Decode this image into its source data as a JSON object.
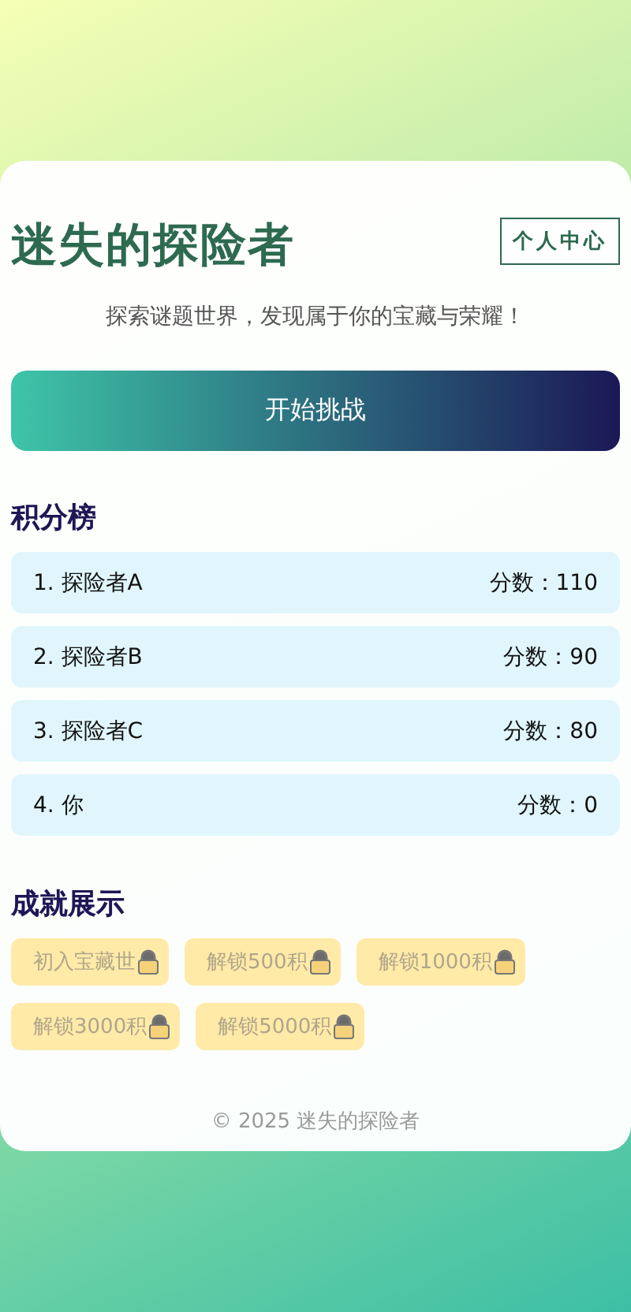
{
  "header": {
    "title": "迷失的探险者",
    "profile_button": "个人中心",
    "subtitle": "探索谜题世界，发现属于你的宝藏与荣耀！"
  },
  "start_button": "开始挑战",
  "leaderboard": {
    "heading": "积分榜",
    "rows": [
      {
        "name": "1. 探险者A",
        "score": "分数：110"
      },
      {
        "name": "2. 探险者B",
        "score": "分数：90"
      },
      {
        "name": "3. 探险者C",
        "score": "分数：80"
      },
      {
        "name": "4. 你",
        "score": "分数：0"
      }
    ]
  },
  "achievements": {
    "heading": "成就展示",
    "items": [
      {
        "label": "初入宝藏世",
        "locked": true
      },
      {
        "label": "解锁500积",
        "locked": true
      },
      {
        "label": "解锁1000积",
        "locked": true
      },
      {
        "label": "解锁3000积",
        "locked": true
      },
      {
        "label": "解锁5000积",
        "locked": true
      }
    ]
  },
  "footer": "© 2025 迷失的探险者"
}
